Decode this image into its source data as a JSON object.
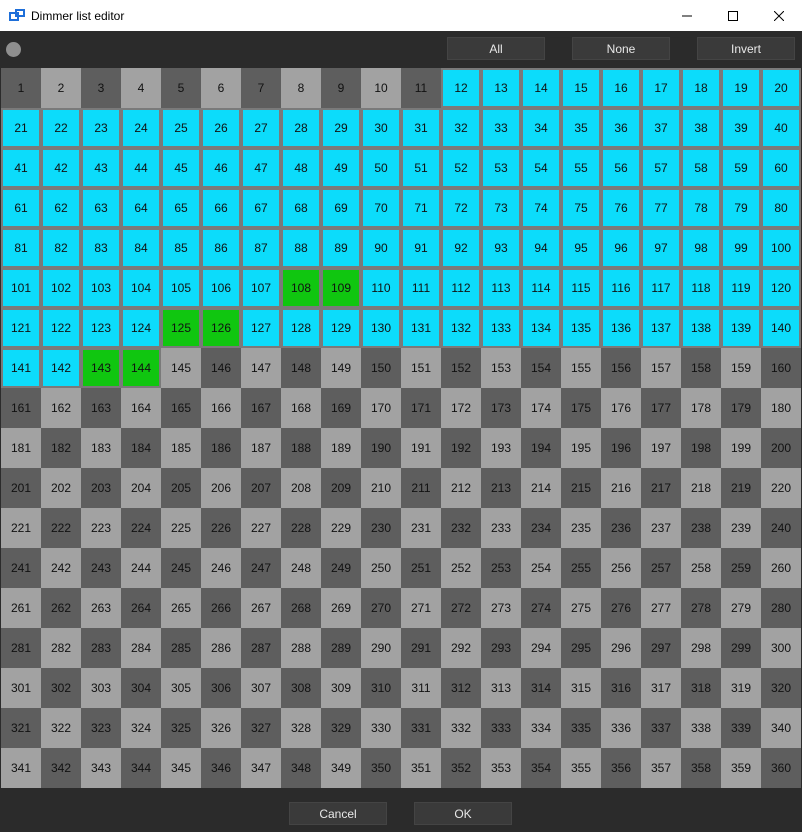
{
  "window": {
    "title": "Dimmer list editor"
  },
  "toolbar": {
    "all_label": "All",
    "none_label": "None",
    "invert_label": "Invert"
  },
  "grid": {
    "start": 1,
    "end": 360,
    "columns": 20,
    "selected_cyan_ranges": [
      [
        12,
        107
      ],
      [
        110,
        124
      ],
      [
        127,
        142
      ]
    ],
    "selected_green": [
      108,
      109,
      125,
      126,
      143,
      144
    ]
  },
  "footer": {
    "cancel_label": "Cancel",
    "ok_label": "OK"
  },
  "colors": {
    "selected": "#0cdcfb",
    "highlight": "#10c610",
    "cell_dark": "#5e5e5e",
    "cell_light": "#a2a2a2",
    "background": "#2b2b2b"
  }
}
